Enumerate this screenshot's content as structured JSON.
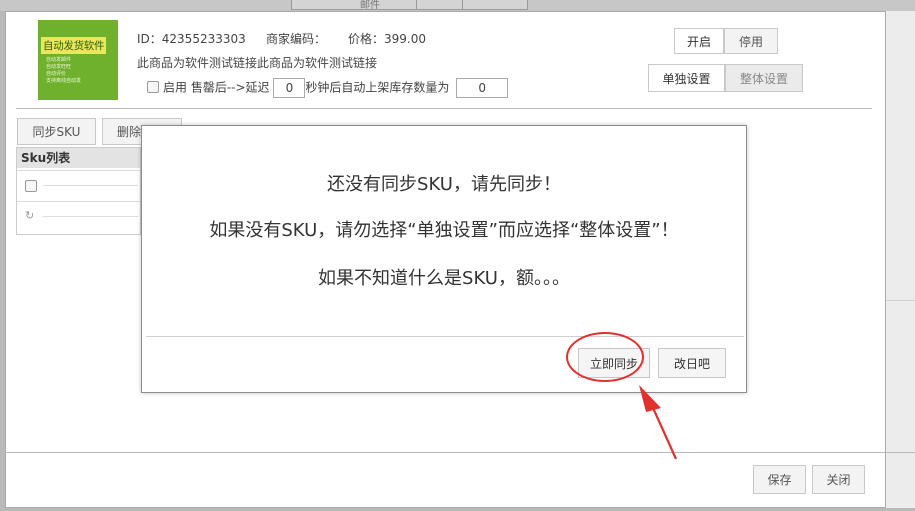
{
  "background": {
    "tab_label": "邮件"
  },
  "product": {
    "thumb_title": "自动发货软件",
    "thumb_lines": [
      "自动发邮件",
      "自动发旺旺",
      "自动评价",
      "支持离线自动发"
    ],
    "id_text": "ID：42355233303",
    "merchant_code_text": "商家编码：",
    "price_text": "价格：399.00",
    "description": "此商品为软件测试链接此商品为软件测试链接",
    "enable_label": "启用",
    "after_sale_text": "售罄后-->延迟",
    "delay_value": "0",
    "seconds_text": "秒钟后自动上架库存数量为",
    "stock_value": "0"
  },
  "toggle": {
    "on_label": "开启",
    "off_label": "停用"
  },
  "mode": {
    "single_label": "单独设置",
    "global_label": "整体设置"
  },
  "toolbar": {
    "sync_sku_label": "同步SKU",
    "delete_label": "删除"
  },
  "sku_list": {
    "header": "Sku列表"
  },
  "dialog": {
    "line1": "还没有同步SKU，请先同步！",
    "line2": "如果没有SKU，请勿选择“单独设置”而应选择“整体设置”！",
    "line3": "如果不知道什么是SKU，额。。。",
    "sync_now_label": "立即同步",
    "later_label": "改日吧"
  },
  "footer": {
    "save_label": "保存",
    "close_label": "关闭"
  },
  "colors": {
    "annotation": "#e0312f",
    "thumb_bg": "#6fb02d"
  }
}
